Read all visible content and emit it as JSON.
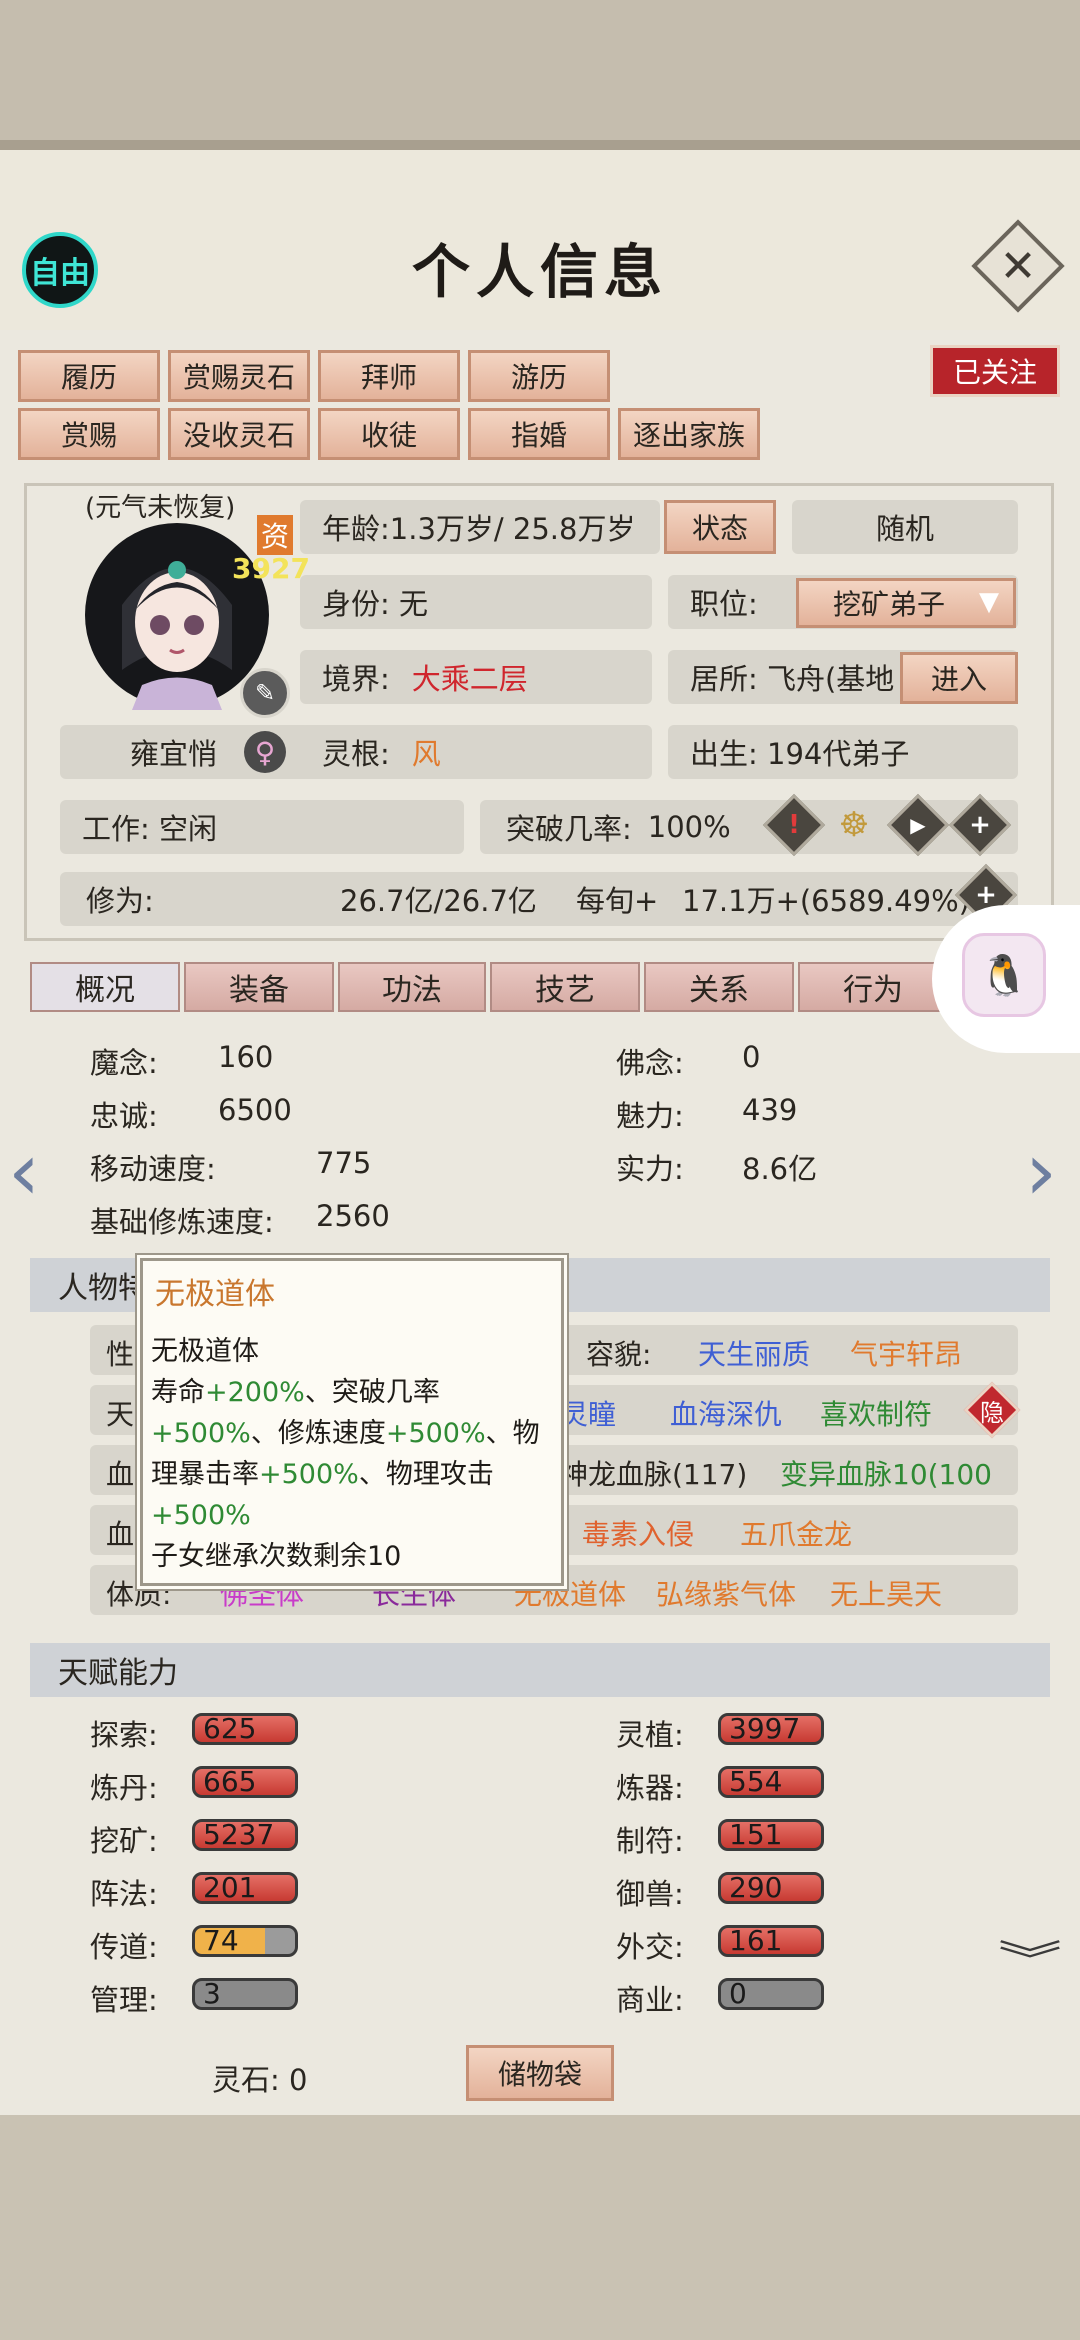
{
  "header": {
    "title": "个人信息",
    "free_label": "自由"
  },
  "actions": {
    "row1": [
      "履历",
      "赏赐灵石",
      "拜师",
      "游历"
    ],
    "row2": [
      "赏赐",
      "没收灵石",
      "收徒",
      "指婚",
      "逐出家族"
    ],
    "follow": "已关注"
  },
  "profile": {
    "status_note": "(元气未恢复)",
    "aptitude_label": "资",
    "aptitude_value": "3927",
    "name": "雍宜悄",
    "gender_icon": "female-icon",
    "age": "年龄:1.3万岁/ 25.8万岁",
    "status_btn": "状态",
    "random_btn": "随机",
    "identity": "身份:  无",
    "position_label": "职位:",
    "position_value": "挖矿弟子",
    "realm_label": "境界:",
    "realm_value": "大乘二层",
    "residence": "居所: 飞舟(基地",
    "enter_btn": "进入",
    "root_label": "灵根:",
    "root_value": "风",
    "birth": "出生:  194代弟子",
    "work": "工作: 空闲",
    "breakthrough_label": "突破几率:",
    "breakthrough_value": "100%",
    "cultivation_label": "修为:",
    "cultivation_value": "26.7亿/26.7亿",
    "per_turn_label": "每旬+",
    "per_turn_value": "17.1万+(6589.49%)"
  },
  "tabs": [
    "概况",
    "装备",
    "功法",
    "技艺",
    "关系",
    "行为"
  ],
  "stats": {
    "demonic_label": "魔念:",
    "demonic": "160",
    "buddha_label": "佛念:",
    "buddha": "0",
    "loyalty_label": "忠诚:",
    "loyalty": "6500",
    "charm_label": "魅力:",
    "charm": "439",
    "speed_label": "移动速度:",
    "speed": "775",
    "power_label": "实力:",
    "power": "8.6亿",
    "base_speed_label": "基础修炼速度:",
    "base_speed": "2560"
  },
  "traits": {
    "section": "人物特",
    "row1_left": "性",
    "appearance_label": "容貌:",
    "appearance1": "天生丽质",
    "appearance2": "气宇轩昂",
    "row2_left": "天",
    "row2_a": "灵瞳",
    "row2_b": "血海深仇",
    "row2_c": "喜欢制符",
    "hide_btn": "隐",
    "row3_left": "血",
    "row3_a": "神龙血脉(117)",
    "row3_b": "变异血脉10(100",
    "row4_left": "血",
    "row4_a": "毒素入侵",
    "row4_b": "五爪金龙",
    "physique_label": "体质:",
    "physique1": "佛圣体",
    "physique2": "长生体",
    "physique3": "无极道体",
    "physique4": "弘缘紫气体",
    "physique5": "无上昊天"
  },
  "tooltip": {
    "title": "无极道体",
    "name": "无极道体",
    "l1a": "寿命",
    "l1b": "+200%",
    "l1c": "、突破几率",
    "l2a": "+500%",
    "l2b": "、修炼速度",
    "l2c": "+500%",
    "l2d": "、物",
    "l3a": "理暴击率",
    "l3b": "+500%",
    "l3c": "、物理攻击",
    "l4a": "+500%",
    "l5": "子女继承次数剩余10"
  },
  "talents": {
    "section": "天赋能力",
    "items": [
      {
        "label": "探索:",
        "value": "625"
      },
      {
        "label": "灵植:",
        "value": "3997"
      },
      {
        "label": "炼丹:",
        "value": "665"
      },
      {
        "label": "炼器:",
        "value": "554"
      },
      {
        "label": "挖矿:",
        "value": "5237"
      },
      {
        "label": "制符:",
        "value": "151"
      },
      {
        "label": "阵法:",
        "value": "201"
      },
      {
        "label": "御兽:",
        "value": "290"
      },
      {
        "label": "传道:",
        "value": "74"
      },
      {
        "label": "外交:",
        "value": "161"
      },
      {
        "label": "管理:",
        "value": "3"
      },
      {
        "label": "商业:",
        "value": "0"
      }
    ]
  },
  "footer": {
    "spirit_stone": "灵石: 0",
    "storage_bag": "储物袋"
  }
}
